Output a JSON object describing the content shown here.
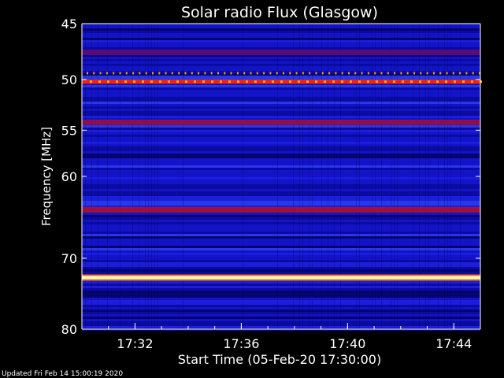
{
  "chart_data": {
    "type": "heatmap",
    "title": "Solar radio Flux (Glasgow)",
    "xlabel": "Start Time (05-Feb-20 17:30:00)",
    "ylabel": "Frequency [MHz]",
    "x_tick_labels": [
      "17:32",
      "17:36",
      "17:40",
      "17:44"
    ],
    "x_tick_minutes": [
      2,
      6,
      10,
      14
    ],
    "x_range_minutes": [
      0,
      15
    ],
    "y_ticks": [
      45,
      50,
      55,
      60,
      70,
      80
    ],
    "y_tick_labels": [
      "45",
      "50",
      "55",
      "60",
      "70",
      "80"
    ],
    "y_range_mhz": [
      45,
      80
    ],
    "y_scale": "log",
    "background_color": "#1010c8",
    "bright_bands": [
      {
        "freq_mhz": 50.2,
        "color": "#ff2000",
        "intensity": "high"
      },
      {
        "freq_mhz": 49.4,
        "color": "#ff9a00",
        "intensity": "dotted"
      },
      {
        "freq_mhz": 47.5,
        "color": "#5a0a7a",
        "intensity": "medium"
      },
      {
        "freq_mhz": 54.2,
        "color": "#8a0f4c",
        "intensity": "medium"
      },
      {
        "freq_mhz": 63.9,
        "color": "#a0103c",
        "intensity": "medium"
      },
      {
        "freq_mhz": 72.6,
        "color": "#ffffc8",
        "intensity": "very-high"
      }
    ],
    "grid": false
  },
  "footer": {
    "updated": "Updated Fri Feb 14 15:00:19 2020"
  }
}
